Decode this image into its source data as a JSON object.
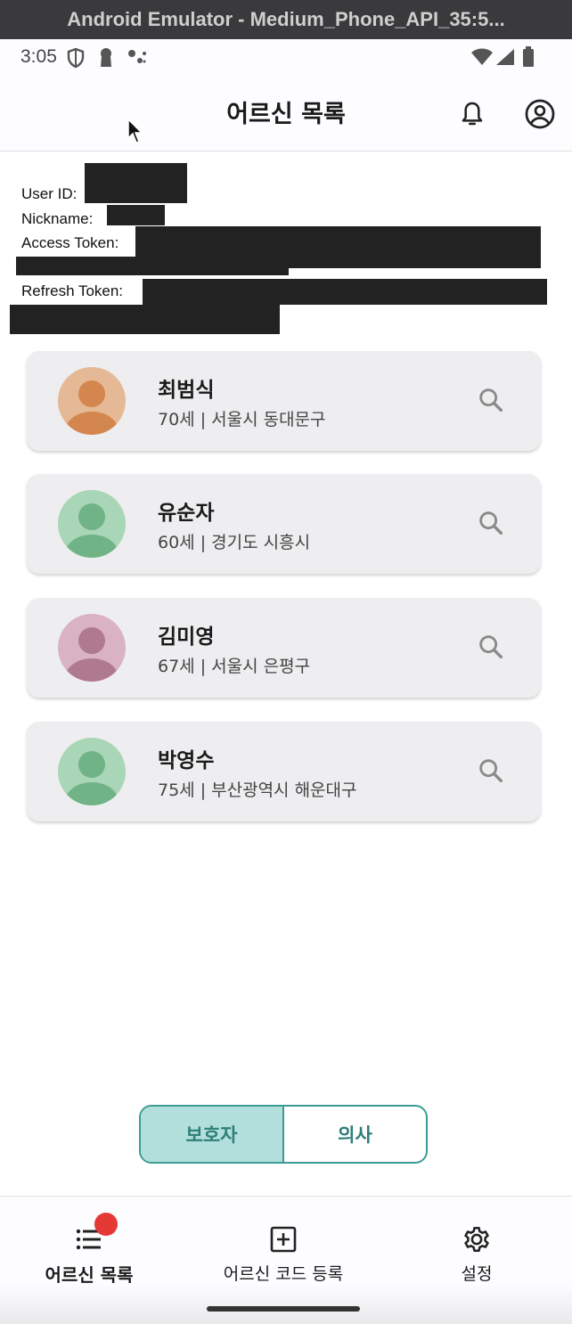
{
  "window": {
    "title": "Android Emulator - Medium_Phone_API_35:5..."
  },
  "status_bar": {
    "time": "3:05"
  },
  "app_bar": {
    "title": "어르신 목록",
    "icons": [
      "bell-icon",
      "account-circle-icon"
    ]
  },
  "user_info": {
    "user_id_label": "User ID:",
    "nickname_label": "Nickname:",
    "access_token_label": "Access Token:",
    "refresh_token_label": "Refresh Token:"
  },
  "elders": [
    {
      "name": "최범식",
      "details": "70세 | 서울시 동대문구",
      "avatar_color": "#d4864f",
      "avatar_bg": "#e6b996"
    },
    {
      "name": "유순자",
      "details": "60세 | 경기도 시흥시",
      "avatar_color": "#6fb386",
      "avatar_bg": "#a9d6b6"
    },
    {
      "name": "김미영",
      "details": "67세 | 서울시 은평구",
      "avatar_color": "#b07a8e",
      "avatar_bg": "#d9b3c1"
    },
    {
      "name": "박영수",
      "details": "75세 | 부산광역시 해운대구",
      "avatar_color": "#6fb386",
      "avatar_bg": "#a9d6b6"
    }
  ],
  "role_toggle": {
    "options": [
      "보호자",
      "의사"
    ],
    "selected": "보호자",
    "accent": "#3a9d93",
    "active_bg": "#b2dfdb"
  },
  "bottom_nav": {
    "items": [
      {
        "label": "어르신 목록",
        "icon": "list-icon",
        "badge": true
      },
      {
        "label": "어르신 코드 등록",
        "icon": "add-box-icon",
        "badge": false
      },
      {
        "label": "설정",
        "icon": "gear-icon",
        "badge": false
      }
    ]
  }
}
